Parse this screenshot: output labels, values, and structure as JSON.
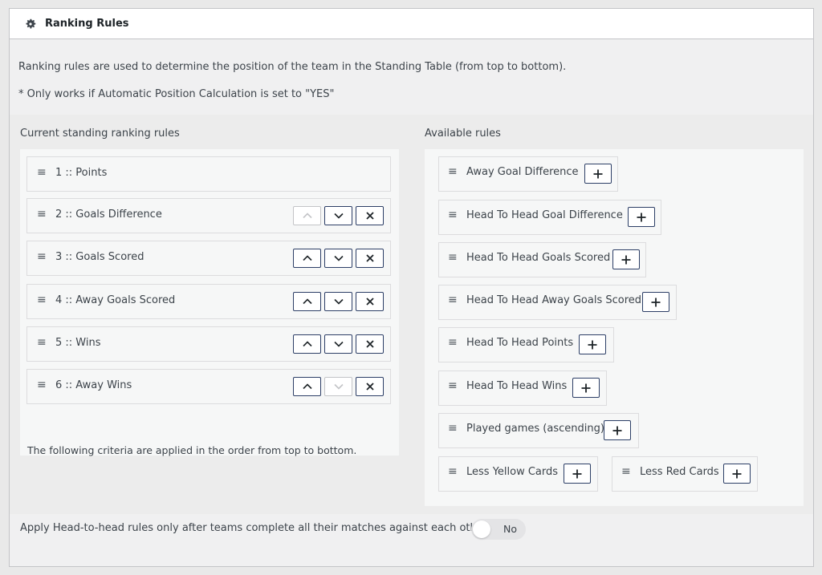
{
  "header": {
    "title": "Ranking Rules"
  },
  "intro": {
    "line1": "Ranking rules are used to determine the position of the team in the Standing Table (from top to bottom).",
    "line2": "* Only works if Automatic Position Calculation is set to \"YES\""
  },
  "current": {
    "title": "Current standing ranking rules",
    "rules": [
      {
        "label": "1 :: Points",
        "up_enabled": false,
        "down_enabled": false,
        "deletable": false
      },
      {
        "label": "2 :: Goals Difference",
        "up_enabled": false,
        "down_enabled": true,
        "deletable": true
      },
      {
        "label": "3 :: Goals Scored",
        "up_enabled": true,
        "down_enabled": true,
        "deletable": true
      },
      {
        "label": "4 :: Away Goals Scored",
        "up_enabled": true,
        "down_enabled": true,
        "deletable": true
      },
      {
        "label": "5 :: Wins",
        "up_enabled": true,
        "down_enabled": true,
        "deletable": true
      },
      {
        "label": "6 :: Away Wins",
        "up_enabled": true,
        "down_enabled": false,
        "deletable": true
      }
    ],
    "footnote": "The following criteria are applied in the order from top to bottom."
  },
  "available": {
    "title": "Available rules",
    "items": [
      "Away Goal Difference",
      "Head To Head Goal Difference",
      "Head To Head Goals Scored",
      "Head To Head Away Goals Scored",
      "Head To Head Points",
      "Head To Head Wins",
      "Played games (ascending)",
      "Less Yellow Cards",
      "Less Red Cards"
    ]
  },
  "h2h": {
    "text": "Apply Head-to-head rules only after teams complete all their matches against each other",
    "toggle_label": "No",
    "toggle_on": false
  },
  "icons": {
    "handle": "drag-handle-icon",
    "gear": "gear-icon"
  },
  "colors": {
    "button_border": "#2c3e66",
    "disabled": "#c3c4c7"
  }
}
